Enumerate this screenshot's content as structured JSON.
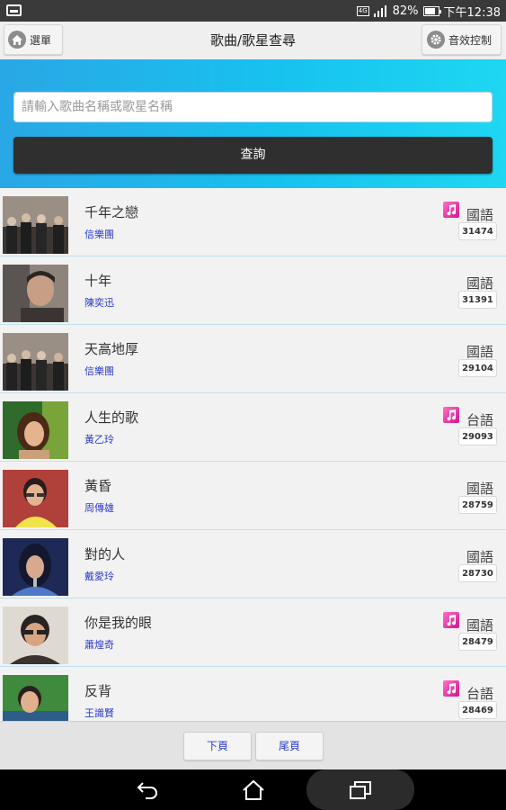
{
  "status_bar": {
    "network": "4G",
    "battery": "82%",
    "time": "下午12:38"
  },
  "title_bar": {
    "menu_label": "選單",
    "title": "歌曲/歌星查尋",
    "effects_label": "音效控制"
  },
  "search": {
    "placeholder": "請輸入歌曲名稱或歌星名稱",
    "value": "",
    "button_label": "查詢"
  },
  "songs": [
    {
      "title": "千年之戀",
      "artist": "信樂團",
      "language": "國語",
      "count": "31474",
      "has_music_icon": true
    },
    {
      "title": "十年",
      "artist": "陳奕迅",
      "language": "國語",
      "count": "31391",
      "has_music_icon": false
    },
    {
      "title": "天高地厚",
      "artist": "信樂團",
      "language": "國語",
      "count": "29104",
      "has_music_icon": false
    },
    {
      "title": "人生的歌",
      "artist": "黃乙玲",
      "language": "台語",
      "count": "29093",
      "has_music_icon": true
    },
    {
      "title": "黃昏",
      "artist": "周傳雄",
      "language": "國語",
      "count": "28759",
      "has_music_icon": false
    },
    {
      "title": "對的人",
      "artist": "戴愛玲",
      "language": "國語",
      "count": "28730",
      "has_music_icon": false
    },
    {
      "title": "你是我的眼",
      "artist": "蕭煌奇",
      "language": "國語",
      "count": "28479",
      "has_music_icon": true
    },
    {
      "title": "反背",
      "artist": "王識賢",
      "language": "台語",
      "count": "28469",
      "has_music_icon": true
    }
  ],
  "pagination": {
    "next_label": "下頁",
    "last_label": "尾頁"
  },
  "colors": {
    "search_gradient_start": "#2aa7e6",
    "search_gradient_end": "#1ed7f2",
    "query_button": "#2f2f2f",
    "artist_text": "#2a3bd0",
    "music_icon": "#e23aa8"
  },
  "icons": {
    "menu": "home-icon",
    "effects": "gear-icon",
    "song_flag": "music-note-icon",
    "nav": [
      "back-icon",
      "home-icon",
      "recent-apps-icon"
    ]
  }
}
